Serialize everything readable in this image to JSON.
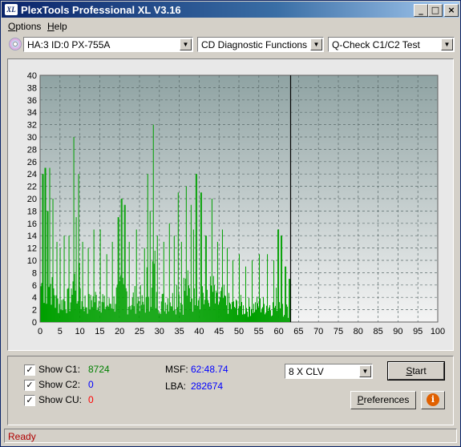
{
  "window": {
    "title": "PlexTools Professional XL V3.16",
    "icon_text": "XL"
  },
  "title_buttons": {
    "minimize": "_",
    "maximize": "□",
    "close": "×"
  },
  "menu": [
    {
      "label": "Options",
      "key": "O"
    },
    {
      "label": "Help",
      "key": "H"
    }
  ],
  "toolbar": {
    "drive": "HA:3 ID:0  PX-755A",
    "function": "CD Diagnostic Functions",
    "test": "Q-Check C1/C2 Test"
  },
  "chart_data": {
    "type": "bar",
    "xlim": [
      0,
      100
    ],
    "ylim": [
      0,
      40
    ],
    "x_ticks": [
      0,
      5,
      10,
      15,
      20,
      25,
      30,
      35,
      40,
      45,
      50,
      55,
      60,
      65,
      70,
      75,
      80,
      85,
      90,
      95,
      100
    ],
    "y_ticks": [
      0,
      2,
      4,
      6,
      8,
      10,
      12,
      14,
      16,
      18,
      20,
      22,
      24,
      26,
      28,
      30,
      32,
      34,
      36,
      38,
      40
    ],
    "grid": true,
    "progress_marker_x": 63,
    "colors": {
      "bars": "#00a000",
      "plot_bg_top": "#8fa3a3",
      "plot_bg_bottom": "#f4f4f4",
      "marker": "#000000"
    },
    "peaks": [
      {
        "x": 0.6,
        "y": 24
      },
      {
        "x": 1.2,
        "y": 25
      },
      {
        "x": 1.8,
        "y": 18
      },
      {
        "x": 2.4,
        "y": 25
      },
      {
        "x": 3.2,
        "y": 20
      },
      {
        "x": 4.2,
        "y": 13
      },
      {
        "x": 5.0,
        "y": 12
      },
      {
        "x": 6.0,
        "y": 14
      },
      {
        "x": 7.2,
        "y": 14
      },
      {
        "x": 8.4,
        "y": 30
      },
      {
        "x": 9.0,
        "y": 17
      },
      {
        "x": 9.6,
        "y": 24
      },
      {
        "x": 10.6,
        "y": 13
      },
      {
        "x": 12.0,
        "y": 12
      },
      {
        "x": 13.4,
        "y": 15
      },
      {
        "x": 15.0,
        "y": 15
      },
      {
        "x": 16.6,
        "y": 11
      },
      {
        "x": 18.0,
        "y": 13
      },
      {
        "x": 19.6,
        "y": 17
      },
      {
        "x": 20.4,
        "y": 20
      },
      {
        "x": 21.2,
        "y": 19
      },
      {
        "x": 22.4,
        "y": 13
      },
      {
        "x": 24.2,
        "y": 15
      },
      {
        "x": 26.2,
        "y": 12
      },
      {
        "x": 27.0,
        "y": 24
      },
      {
        "x": 27.6,
        "y": 18
      },
      {
        "x": 28.4,
        "y": 32
      },
      {
        "x": 29.4,
        "y": 14
      },
      {
        "x": 31.0,
        "y": 13
      },
      {
        "x": 32.4,
        "y": 16
      },
      {
        "x": 33.6,
        "y": 14
      },
      {
        "x": 34.6,
        "y": 21
      },
      {
        "x": 35.4,
        "y": 13
      },
      {
        "x": 36.6,
        "y": 22
      },
      {
        "x": 37.8,
        "y": 19
      },
      {
        "x": 38.4,
        "y": 15
      },
      {
        "x": 39.2,
        "y": 24
      },
      {
        "x": 40.4,
        "y": 21
      },
      {
        "x": 41.6,
        "y": 14
      },
      {
        "x": 43.2,
        "y": 20
      },
      {
        "x": 44.6,
        "y": 13
      },
      {
        "x": 45.8,
        "y": 15
      },
      {
        "x": 47.0,
        "y": 12
      },
      {
        "x": 48.4,
        "y": 10
      },
      {
        "x": 50.0,
        "y": 11
      },
      {
        "x": 51.6,
        "y": 9
      },
      {
        "x": 53.2,
        "y": 10
      },
      {
        "x": 55.0,
        "y": 11
      },
      {
        "x": 57.0,
        "y": 11
      },
      {
        "x": 58.6,
        "y": 10
      },
      {
        "x": 59.8,
        "y": 15
      },
      {
        "x": 60.6,
        "y": 14
      },
      {
        "x": 61.6,
        "y": 9
      },
      {
        "x": 62.6,
        "y": 7
      }
    ]
  },
  "stats": {
    "show_c1": {
      "label": "Show C1:",
      "checked": true,
      "value": "8724",
      "color": "#008000"
    },
    "show_c2": {
      "label": "Show C2:",
      "checked": true,
      "value": "0",
      "color": "#0000ff"
    },
    "show_cu": {
      "label": "Show CU:",
      "checked": true,
      "value": "0",
      "color": "#ff0000"
    },
    "msf": {
      "label": "MSF:",
      "value": "62:48.74",
      "color": "#0000ff"
    },
    "lba": {
      "label": "LBA:",
      "value": "282674",
      "color": "#0000ff"
    }
  },
  "speed_select": "8 X CLV",
  "buttons": {
    "start": "Start",
    "start_key": "S",
    "preferences": "Preferences",
    "preferences_key": "P",
    "info": "i"
  },
  "status_text": "Ready"
}
